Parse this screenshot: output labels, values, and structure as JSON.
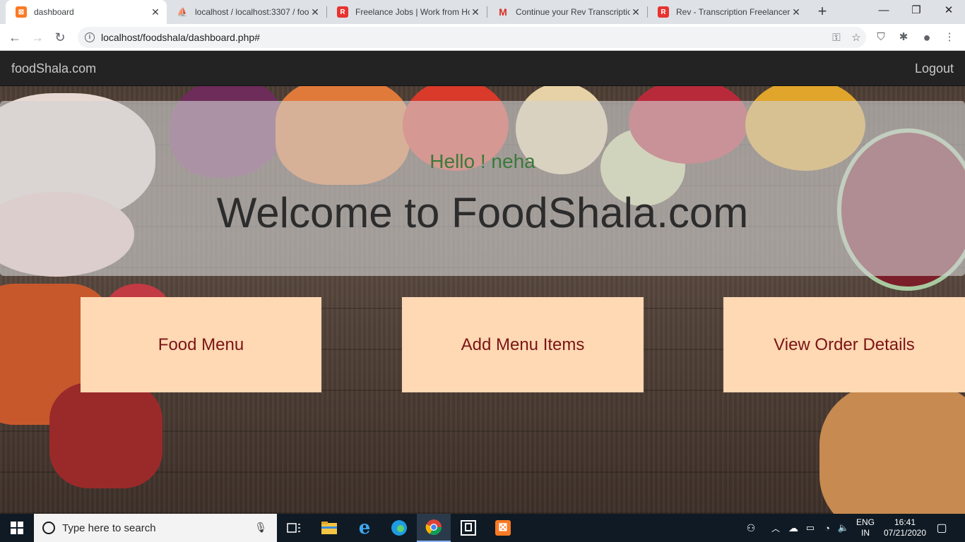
{
  "browser": {
    "tabs": [
      {
        "title": "dashboard",
        "favicon": "xampp-icon",
        "favicon_color": "#fb7a24",
        "active": true
      },
      {
        "title": "localhost / localhost:3307 / foo",
        "favicon": "phpmyadmin-icon",
        "favicon_color": "#f7a21b",
        "active": false
      },
      {
        "title": "Freelance Jobs | Work from Ho",
        "favicon": "rev-icon",
        "favicon_color": "#e8332f",
        "active": false
      },
      {
        "title": "Continue your Rev Transcriptio",
        "favicon": "gmail-icon",
        "favicon_color": "#d93025",
        "active": false
      },
      {
        "title": "Rev - Transcription Freelancer A",
        "favicon": "rev-icon",
        "favicon_color": "#e8332f",
        "active": false
      }
    ],
    "url": "localhost/foodshala/dashboard.php#"
  },
  "navbar": {
    "brand": "foodShala.com",
    "logout": "Logout"
  },
  "hero": {
    "greeting": "Hello ! neha",
    "welcome": "Welcome to FoodShala.com"
  },
  "actions": [
    {
      "label": "Food Menu"
    },
    {
      "label": "Add Menu Items"
    },
    {
      "label": "View Order Details"
    }
  ],
  "taskbar": {
    "search_placeholder": "Type here to search",
    "language": "ENG",
    "region": "IN",
    "time": "16:41",
    "date": "07/21/2020"
  },
  "colors": {
    "card_bg": "#ffd8b4",
    "card_text": "#7a1414",
    "greeting": "#3a7a3a",
    "navbar_bg": "#232323"
  }
}
